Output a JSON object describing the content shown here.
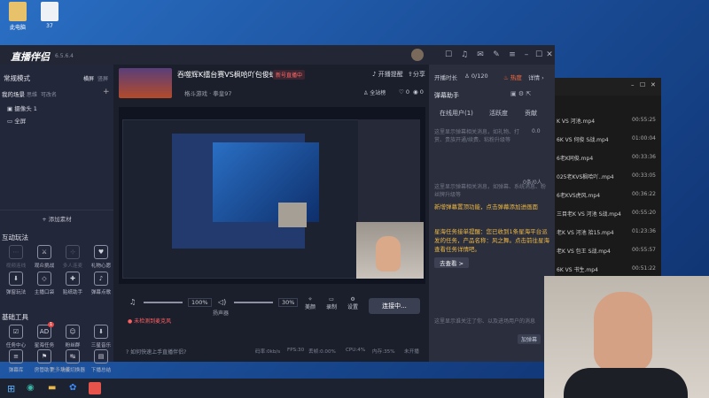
{
  "desktop": {
    "icons": [
      {
        "label": "此电脑"
      },
      {
        "label": "37"
      }
    ]
  },
  "app": {
    "logo": "直播伴侣",
    "version": "6.5.6.4"
  },
  "left": {
    "mode_label": "常规模式",
    "mode_tab_landscape": "横屏",
    "mode_tab_portrait": "竖屏",
    "scene_title": "我的场景",
    "scene_link1": "思维",
    "scene_link2": "可改名",
    "sources": [
      "摄像头 1",
      "全屏"
    ],
    "add_source": "添加素材",
    "interact_title": "互动玩法",
    "interact_items": [
      {
        "label": "视频连线",
        "icon": "⋯",
        "dim": true
      },
      {
        "label": "观众挑战",
        "icon": "⚔",
        "dim": false
      },
      {
        "label": "多人连麦",
        "icon": "⊹",
        "dim": true
      },
      {
        "label": "礼物心愿",
        "icon": "♥",
        "dim": false
      },
      {
        "label": "弹窗玩法",
        "icon": "⬇",
        "dim": false
      },
      {
        "label": "主播口袋",
        "icon": "◇",
        "dim": false
      },
      {
        "label": "贴纸助手",
        "icon": "✚",
        "dim": false
      },
      {
        "label": "弹幕点歌",
        "icon": "♪",
        "dim": false
      }
    ],
    "tools_title": "基础工具",
    "tool_items": [
      {
        "label": "任务中心",
        "icon": "☑",
        "badge": ""
      },
      {
        "label": "星海任务",
        "icon": "AD",
        "badge": "1"
      },
      {
        "label": "粉丝群",
        "icon": "☺",
        "badge": ""
      },
      {
        "label": "三星音乐",
        "icon": "⬇",
        "badge": ""
      },
      {
        "label": "弹幕库",
        "icon": "≡",
        "badge": ""
      },
      {
        "label": "房管助手",
        "icon": "⚑",
        "badge": ""
      },
      {
        "label": "场景切换器",
        "icon": "↹",
        "badge": ""
      },
      {
        "label": "下播总结",
        "icon": "▤",
        "badge": ""
      }
    ],
    "more_label": "更多功能"
  },
  "center": {
    "stream_title": "吞噬辉K擂台赛VS枫哈吖包俊虹",
    "status_badge": "新号直播中",
    "category": "格斗游戏 · 拳皇97",
    "notify_label": "开播提醒",
    "share_label": "分享",
    "fans_badge": "全站榜",
    "likes": "0",
    "views": "0",
    "mic_volume": "100%",
    "speaker_label": "扬声器",
    "speaker_volume": "30%",
    "beauty_label": "美颜",
    "record_label": "录制",
    "settings_label": "设置",
    "connect_button": "连接中...",
    "warning": "未检测到麦克风",
    "footer_tip": "如何快速上手直播伴侣?",
    "bitrate": "码率:0kb/s",
    "fps": "FPS:30",
    "drop": "丢帧:0.00%",
    "cpu": "CPU:4%",
    "mem": "内存:35%",
    "live_state": "未开播"
  },
  "right": {
    "live_time_label": "开播时长",
    "audience": "0/120",
    "hot": "热度",
    "detail": "详情",
    "panel_title": "弹幕助手",
    "tabs": [
      "在线用户(1)",
      "活跃度",
      "贡献"
    ],
    "placeholder_msg": "这里显示弹幕相关消息，如礼物、打赏、贵族开通/续费、粘粉升级等",
    "placeholder_msg2": "这里显示弹幕相关消息，如弹幕、系统消息、粉丝牌升级等",
    "count_label": "0.0",
    "online_label": "0条/0人",
    "notice_highlight": "新增弹幕置顶功能，点击弹幕添加进画面",
    "task_notice": "星海任务接单提醒：您已收到1条星海平台派发的任务，产品名称：风之舞。点击前往星海查看任务详情吧。",
    "go_view": "去查看 >",
    "bottom_msg": "这里显示谁关注了你、以及进场用户的消息",
    "clear_button": "加弹幕"
  },
  "files": {
    "rows": [
      {
        "name": "K VS 河池.mp4",
        "time": "00:55:25"
      },
      {
        "name": "6K VS 何俊 S战.mp4",
        "time": "01:00:04"
      },
      {
        "name": "6老K同俊.mp4",
        "time": "00:33:36"
      },
      {
        "name": "025老KVS枫哈吖..mp4",
        "time": "00:33:05"
      },
      {
        "name": "6老KVS虎风.mp4",
        "time": "00:36:22"
      },
      {
        "name": "三目老K VS 河池 S战.mp4",
        "time": "00:55:20"
      },
      {
        "name": "老K VS 河池 拾15.mp4",
        "time": "01:23:36"
      },
      {
        "name": "老K VS 包王 S战.mp4",
        "time": "00:55:57"
      },
      {
        "name": "6K VS 书生.mp4",
        "time": "00:51:22"
      }
    ]
  }
}
